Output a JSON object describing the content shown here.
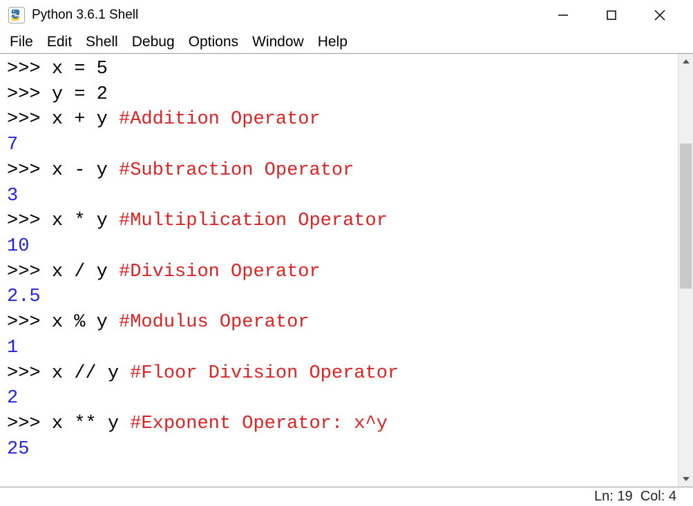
{
  "window": {
    "title": "Python 3.6.1 Shell"
  },
  "menu": {
    "file": "File",
    "edit": "Edit",
    "shell": "Shell",
    "debug": "Debug",
    "options": "Options",
    "window": "Window",
    "help": "Help"
  },
  "lines": [
    {
      "prompt": ">>> ",
      "code": "x = 5",
      "comment": ""
    },
    {
      "prompt": ">>> ",
      "code": "y = 2",
      "comment": ""
    },
    {
      "prompt": ">>> ",
      "code": "x + y ",
      "comment": "#Addition Operator"
    },
    {
      "output": "7"
    },
    {
      "prompt": ">>> ",
      "code": "x - y ",
      "comment": "#Subtraction Operator"
    },
    {
      "output": "3"
    },
    {
      "prompt": ">>> ",
      "code": "x * y ",
      "comment": "#Multiplication Operator"
    },
    {
      "output": "10"
    },
    {
      "prompt": ">>> ",
      "code": "x / y ",
      "comment": "#Division Operator"
    },
    {
      "output": "2.5"
    },
    {
      "prompt": ">>> ",
      "code": "x % y ",
      "comment": "#Modulus Operator"
    },
    {
      "output": "1"
    },
    {
      "prompt": ">>> ",
      "code": "x // y ",
      "comment": "#Floor Division Operator"
    },
    {
      "output": "2"
    },
    {
      "prompt": ">>> ",
      "code": "x ** y ",
      "comment": "#Exponent Operator: x^y"
    },
    {
      "output": "25"
    }
  ],
  "status": {
    "ln_label": "Ln:",
    "ln_value": "19",
    "col_label": "Col:",
    "col_value": "4"
  }
}
